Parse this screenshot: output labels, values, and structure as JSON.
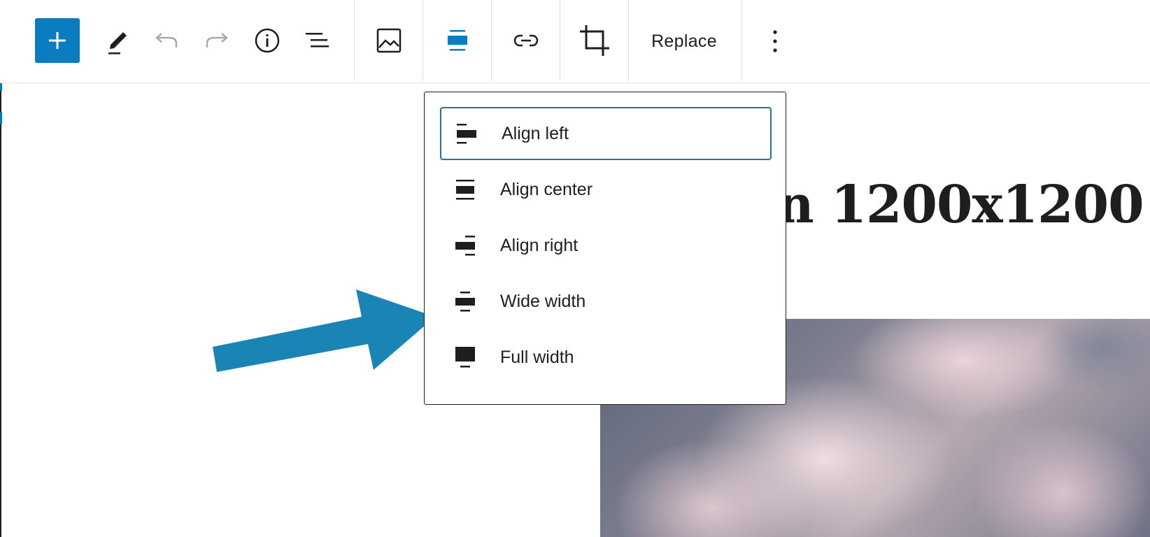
{
  "toolbar": {
    "add_icon": "plus-icon",
    "tools_icon": "pencil-icon",
    "undo_icon": "undo-icon",
    "redo_icon": "redo-icon",
    "details_icon": "info-icon",
    "outline_icon": "list-view-icon",
    "block_type_icon": "image-icon",
    "align_icon": "align-wide-icon",
    "link_icon": "link-icon",
    "crop_icon": "crop-icon",
    "replace_label": "Replace",
    "more_icon": "more-vertical-icon"
  },
  "content": {
    "heading_text": "n 1200x1200"
  },
  "align_menu": {
    "items": [
      {
        "label": "Align left",
        "icon": "align-left-icon"
      },
      {
        "label": "Align center",
        "icon": "align-center-icon"
      },
      {
        "label": "Align right",
        "icon": "align-right-icon"
      },
      {
        "label": "Wide width",
        "icon": "align-wide-icon"
      },
      {
        "label": "Full width",
        "icon": "align-full-width-icon"
      }
    ],
    "focused_item": "Align left"
  },
  "annotation": {
    "arrow_icon": "pointer-arrow-icon",
    "color": "#1a84b4"
  },
  "colors": {
    "accent": "#0a7cc1",
    "focus_border": "#2271b1",
    "text": "#1e1e1e",
    "disabled": "#a7aaad"
  }
}
